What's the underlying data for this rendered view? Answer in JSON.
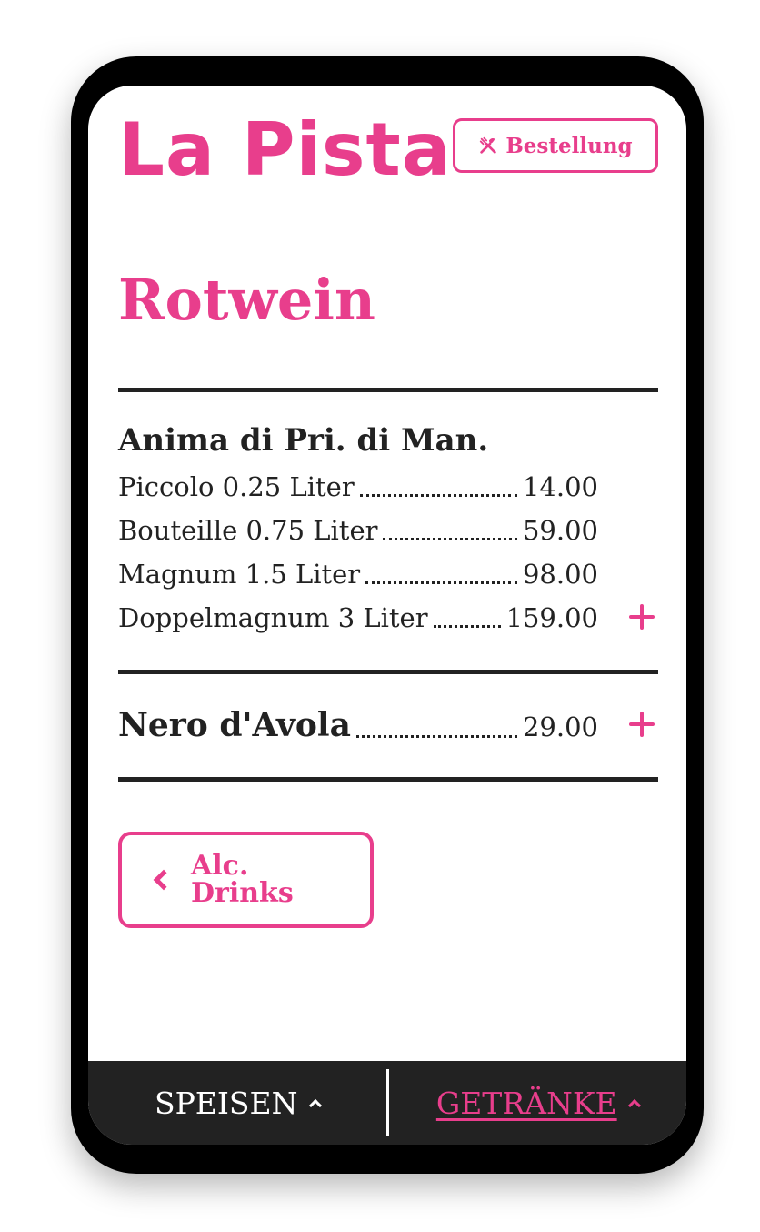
{
  "header": {
    "brand": "La Pista",
    "order_button": "Bestellung",
    "order_icon": "fork-knife-icon"
  },
  "page": {
    "title": "Rotwein"
  },
  "items": [
    {
      "name": "Anima di Pri. di Man.",
      "sizes": [
        {
          "label": "Piccolo 0.25 Liter",
          "price": "14.00"
        },
        {
          "label": "Bouteille 0.75 Liter",
          "price": "59.00"
        },
        {
          "label": "Magnum 1.5 Liter",
          "price": "98.00"
        },
        {
          "label": "Doppelmagnum 3 Liter",
          "price": "159.00"
        }
      ]
    },
    {
      "name": "Nero d'Avola",
      "price": "29.00"
    }
  ],
  "back_button": {
    "line1": "Alc.",
    "line2": "Drinks"
  },
  "bottom_nav": {
    "food": "SPEISEN",
    "drinks": "GETRÄNKE",
    "active": "drinks"
  },
  "colors": {
    "accent": "#e83e8c",
    "text": "#222222",
    "nav_background": "#222222"
  }
}
